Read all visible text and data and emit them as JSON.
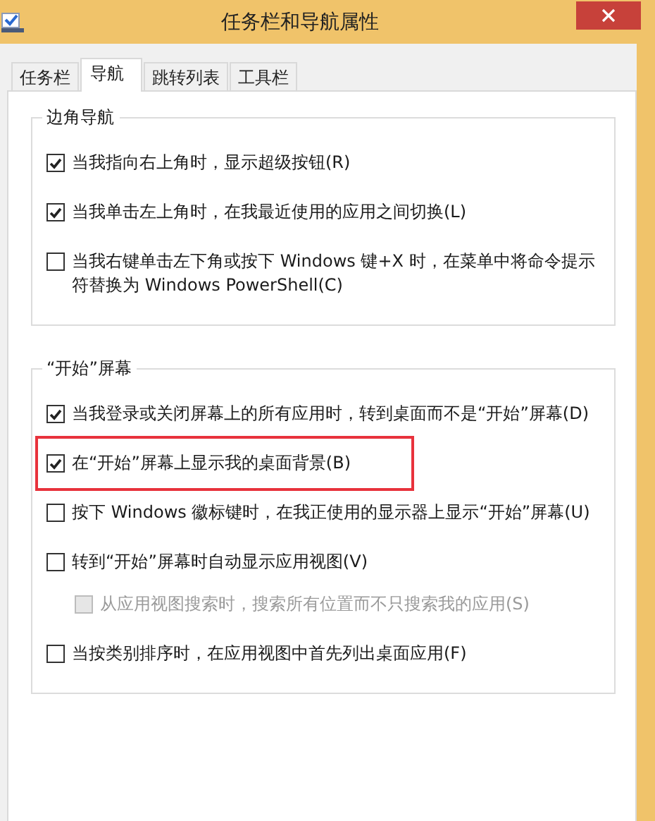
{
  "window": {
    "title": "任务栏和导航属性"
  },
  "tabs": [
    {
      "label": "任务栏",
      "selected": false
    },
    {
      "label": "导航",
      "selected": true
    },
    {
      "label": "跳转列表",
      "selected": false
    },
    {
      "label": "工具栏",
      "selected": false
    }
  ],
  "groups": [
    {
      "title": "边角导航",
      "options": [
        {
          "label": "当我指向右上角时，显示超级按钮(R)",
          "checked": true,
          "disabled": false,
          "highlighted": false
        },
        {
          "label": "当我单击左上角时，在我最近使用的应用之间切换(L)",
          "checked": true,
          "disabled": false,
          "highlighted": false
        },
        {
          "label": "当我右键单击左下角或按下 Windows 键+X 时，在菜单中将命令提示符替换为 Windows PowerShell(C)",
          "checked": false,
          "disabled": false,
          "highlighted": false
        }
      ]
    },
    {
      "title": "“开始”屏幕",
      "options": [
        {
          "label": "当我登录或关闭屏幕上的所有应用时，转到桌面而不是“开始”屏幕(D)",
          "checked": true,
          "disabled": false,
          "highlighted": false
        },
        {
          "label": "在“开始”屏幕上显示我的桌面背景(B)",
          "checked": true,
          "disabled": false,
          "highlighted": true
        },
        {
          "label": "按下 Windows 徽标键时，在我正使用的显示器上显示“开始”屏幕(U)",
          "checked": false,
          "disabled": false,
          "highlighted": false
        },
        {
          "label": "转到“开始”屏幕时自动显示应用视图(V)",
          "checked": false,
          "disabled": false,
          "highlighted": false,
          "children": [
            {
              "label": "从应用视图搜索时，搜索所有位置而不只搜索我的应用(S)",
              "checked": false,
              "disabled": true,
              "highlighted": false
            }
          ]
        },
        {
          "label": "当按类别排序时，在应用视图中首先列出桌面应用(F)",
          "checked": false,
          "disabled": false,
          "highlighted": false
        }
      ]
    }
  ]
}
